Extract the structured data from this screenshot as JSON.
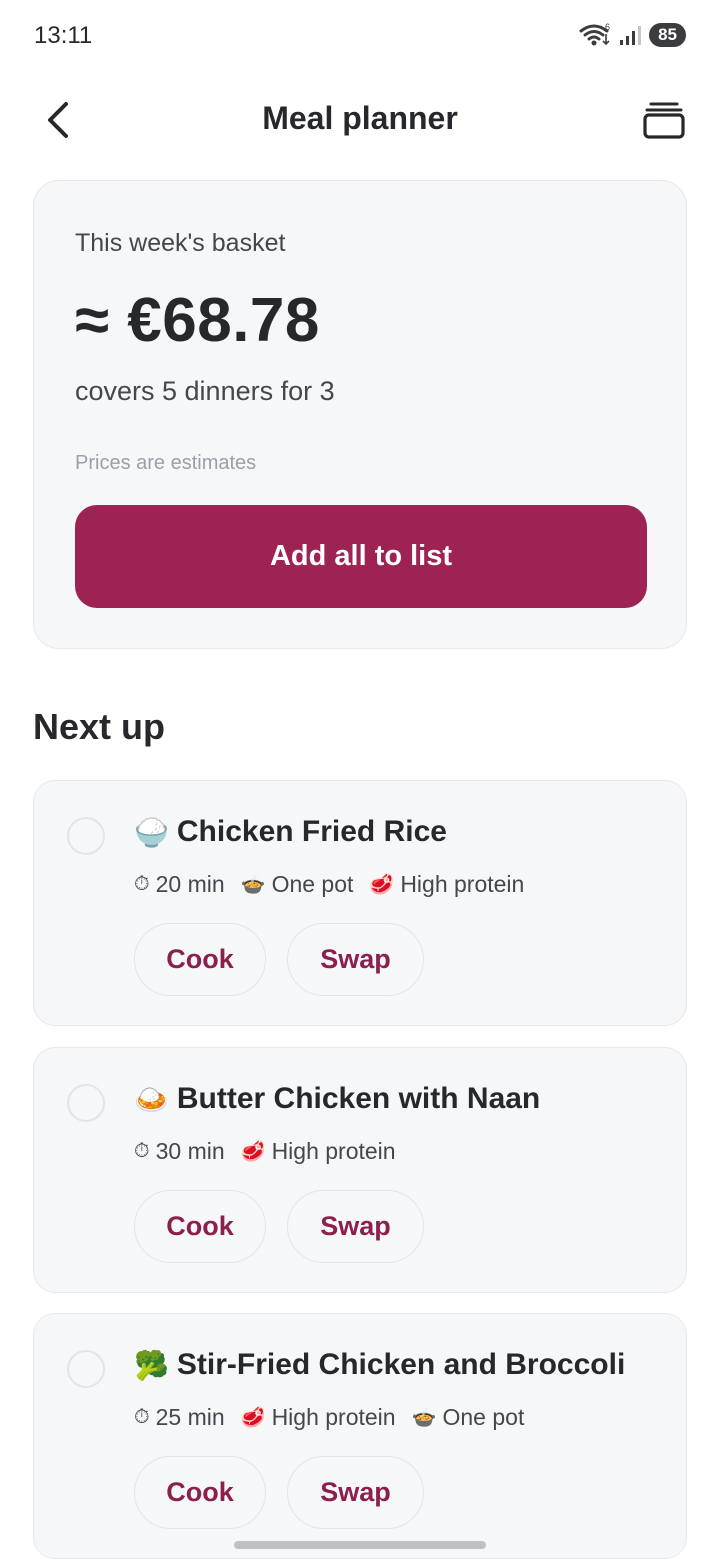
{
  "status_bar": {
    "time": "13:11",
    "wifi_superscript": "6",
    "battery": "85"
  },
  "header": {
    "title": "Meal planner",
    "back_icon": "chevron-left-icon",
    "right_icon": "stack-icon"
  },
  "basket": {
    "label": "This week's basket",
    "price": "≈ €68.78",
    "covers": "covers 5 dinners for 3",
    "note": "Prices are estimates",
    "button_label": "Add all to list"
  },
  "section_title": "Next up",
  "meals": [
    {
      "emoji": "🍚",
      "title": "Chicken Fried Rice",
      "tags": [
        {
          "icon": "⏱",
          "label": "20 min"
        },
        {
          "icon": "🍲",
          "label": "One pot"
        },
        {
          "icon": "🥩",
          "label": "High protein"
        }
      ],
      "cook_label": "Cook",
      "swap_label": "Swap"
    },
    {
      "emoji": "🍛",
      "title": "Butter Chicken with Naan",
      "tags": [
        {
          "icon": "⏱",
          "label": "30 min"
        },
        {
          "icon": "🥩",
          "label": "High protein"
        }
      ],
      "cook_label": "Cook",
      "swap_label": "Swap"
    },
    {
      "emoji": "🥦",
      "title": "Stir-Fried Chicken and Broccoli",
      "tags": [
        {
          "icon": "⏱",
          "label": "25 min"
        },
        {
          "icon": "🥩",
          "label": "High protein"
        },
        {
          "icon": "🍲",
          "label": "One pot"
        }
      ],
      "cook_label": "Cook",
      "swap_label": "Swap"
    }
  ],
  "colors": {
    "accent": "#9e2355",
    "accent_text": "#8c1f4c",
    "card_bg": "#f6f7f9",
    "text_primary": "#26282b"
  }
}
